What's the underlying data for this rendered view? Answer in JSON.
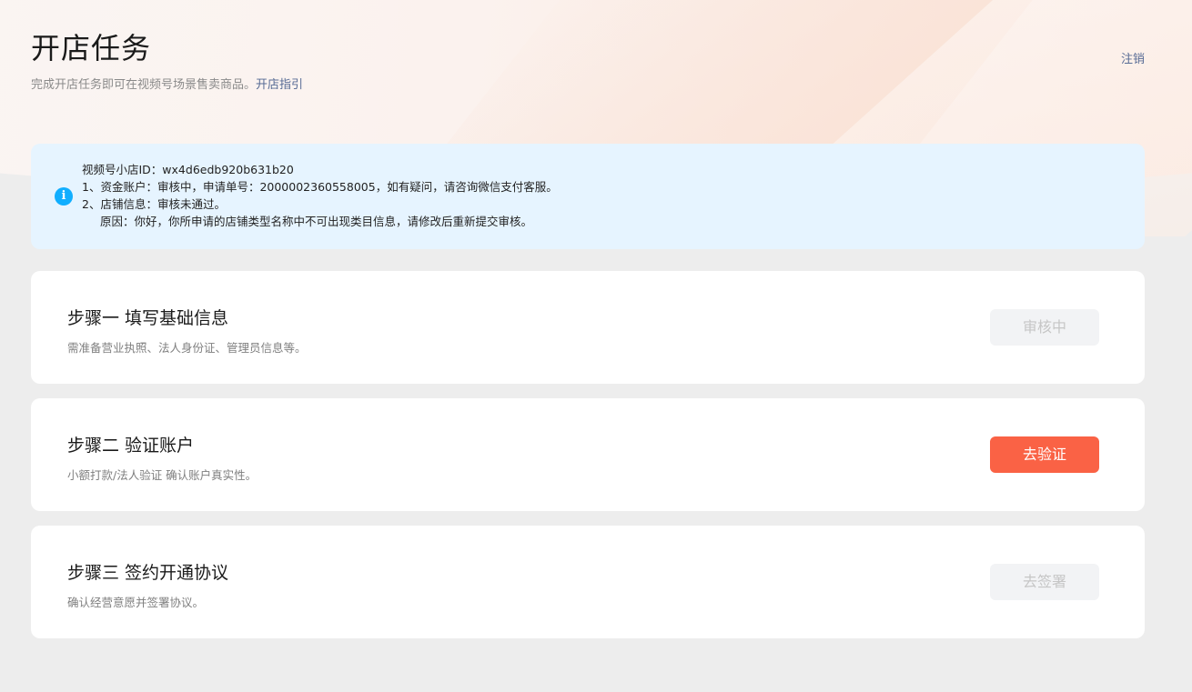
{
  "header": {
    "title": "开店任务",
    "subtitle": "完成开店任务即可在视频号场景售卖商品。",
    "guide_link": "开店指引",
    "logout": "注销"
  },
  "notice": {
    "icon": "info-icon",
    "line1": "视频号小店ID：wx4d6edb920b631b20",
    "line2": "1、资金账户：审核中，申请单号：2000002360558005，如有疑问，请咨询微信支付客服。",
    "line3": "2、店铺信息：审核未通过。",
    "line4": "原因：你好，你所申请的店铺类型名称中不可出现类目信息，请修改后重新提交审核。"
  },
  "steps": [
    {
      "title": "步骤一 填写基础信息",
      "desc": "需准备营业执照、法人身份证、管理员信息等。",
      "button": "审核中",
      "button_state": "disabled"
    },
    {
      "title": "步骤二 验证账户",
      "desc": "小额打款/法人验证 确认账户真实性。",
      "button": "去验证",
      "button_state": "primary"
    },
    {
      "title": "步骤三 签约开通协议",
      "desc": "确认经营意愿并签署协议。",
      "button": "去签署",
      "button_state": "disabled"
    }
  ],
  "colors": {
    "accent": "#fa6245",
    "link": "#576b95",
    "info": "#10aeff",
    "notice_bg": "#e6f4ff"
  }
}
